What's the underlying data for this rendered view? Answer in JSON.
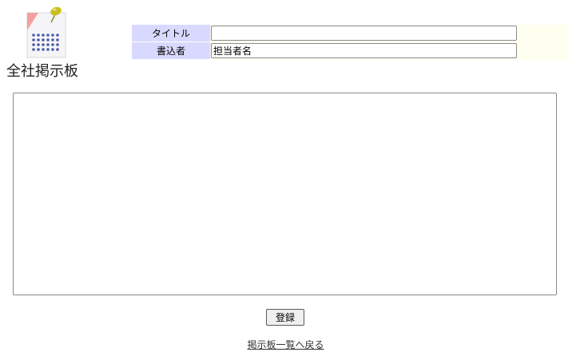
{
  "logo": {
    "text": "全社掲示板"
  },
  "form": {
    "title_label": "タイトル",
    "title_value": "",
    "author_label": "書込者",
    "author_value": "担当者名",
    "body_value": ""
  },
  "actions": {
    "submit_label": "登録"
  },
  "nav": {
    "back_link": "掲示板一覧へ戻る"
  },
  "colors": {
    "label_bg": "#d9d9ff",
    "form_bg": "#fffff0",
    "pin_color": "#c8c020",
    "corner_color": "#f4a0a0",
    "dot_color": "#4a5aa8"
  }
}
